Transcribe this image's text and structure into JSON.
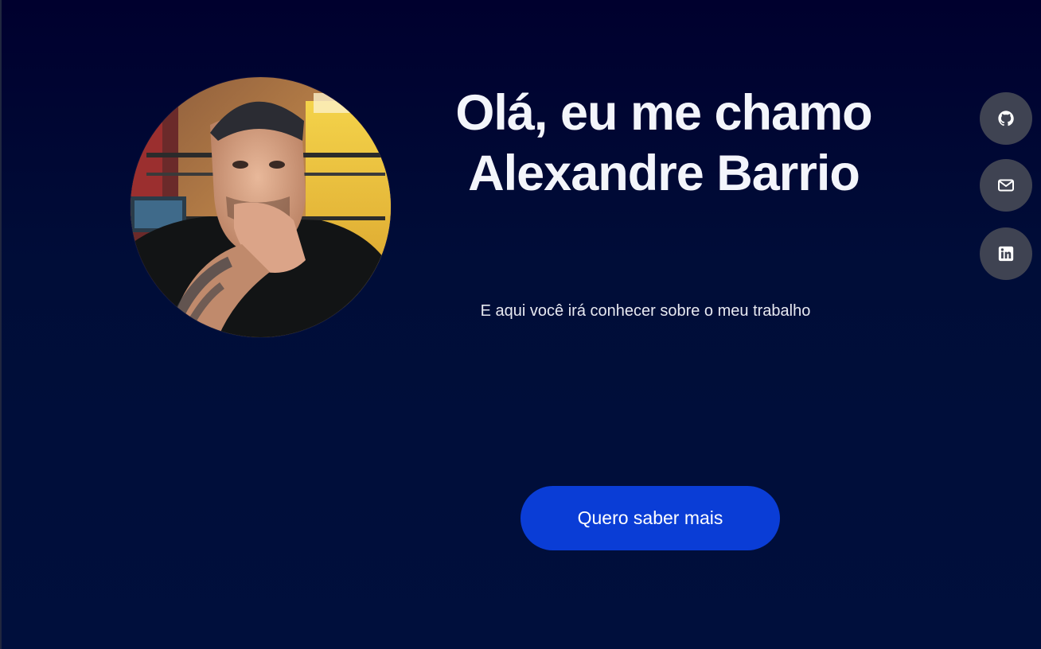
{
  "hero": {
    "headline_line1": "Olá, eu me chamo",
    "headline_line2": "Alexandre Barrio",
    "subtitle": "E aqui você irá conhecer sobre o meu trabalho",
    "cta_label": "Quero saber mais",
    "avatar_alt": "Alexandre Barrio"
  },
  "social": [
    {
      "name": "github",
      "icon": "github-icon"
    },
    {
      "name": "email",
      "icon": "mail-icon"
    },
    {
      "name": "linkedin",
      "icon": "linkedin-icon"
    }
  ],
  "colors": {
    "background_top": "#00002e",
    "background_bottom": "#000f3c",
    "cta": "#0a3dd6",
    "social_button": "#3f4352",
    "text": "#f3f5fb"
  }
}
